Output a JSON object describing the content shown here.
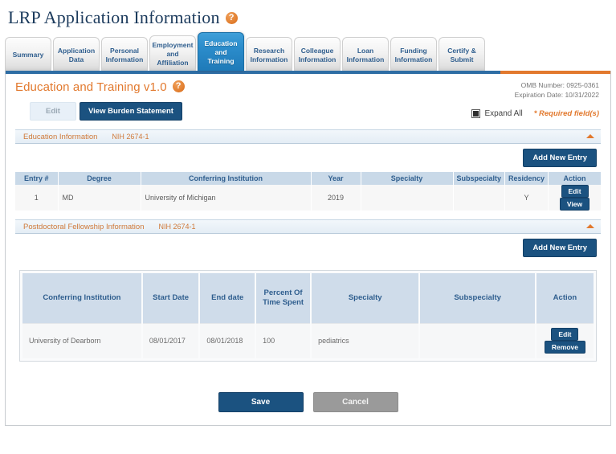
{
  "header": {
    "title": "LRP Application Information",
    "help_icon": "help-question-icon",
    "help_glyph": "?"
  },
  "tabs": [
    {
      "label": "Summary",
      "active": false
    },
    {
      "label": "Application Data",
      "active": false
    },
    {
      "label": "Personal Information",
      "active": false
    },
    {
      "label": "Employment and Affiliation",
      "active": false
    },
    {
      "label": "Education and Training",
      "active": true
    },
    {
      "label": "Research Information",
      "active": false
    },
    {
      "label": "Colleague Information",
      "active": false
    },
    {
      "label": "Loan Information",
      "active": false
    },
    {
      "label": "Funding Information",
      "active": false
    },
    {
      "label": "Certify & Submit",
      "active": false
    }
  ],
  "form": {
    "title": "Education and Training v1.0",
    "help_glyph": "?",
    "omb_number": "OMB Number: 0925-0361",
    "expiration_date": "Expiration Date: 10/31/2022",
    "edit_label": "Edit",
    "burden_label": "View Burden Statement",
    "expand_all_label": "Expand All",
    "required_note": "* Required field(s)"
  },
  "education_section": {
    "label": "Education Information",
    "form_number": "NIH 2674-1",
    "add_label": "Add New Entry",
    "columns": [
      "Entry #",
      "Degree",
      "Conferring Institution",
      "Year",
      "Specialty",
      "Subspecialty",
      "Residency",
      "Action"
    ],
    "rows": [
      {
        "entry": "1",
        "degree": "MD",
        "institution": "University of Michigan",
        "year": "2019",
        "specialty": "",
        "subspecialty": "",
        "residency": "Y",
        "actions": [
          "Edit",
          "View"
        ]
      }
    ]
  },
  "postdoc_section": {
    "label": "Postdoctoral Fellowship Information",
    "form_number": "NIH 2674-1",
    "add_label": "Add New Entry",
    "columns": [
      "Conferring Institution",
      "Start Date",
      "End date",
      "Percent Of Time Spent",
      "Specialty",
      "Subspecialty",
      "Action"
    ],
    "rows": [
      {
        "institution": "University of Dearborn",
        "start_date": "08/01/2017",
        "end_date": "08/01/2018",
        "percent": "100",
        "specialty": "pediatrics",
        "subspecialty": "",
        "actions": [
          "Edit",
          "Remove"
        ]
      }
    ]
  },
  "footer": {
    "save_label": "Save",
    "cancel_label": "Cancel"
  },
  "colors": {
    "brand_blue": "#2e6da4",
    "brand_orange": "#e2792e",
    "active_tab": "#1f7ab8",
    "button_navy": "#1b5280",
    "table_header": "#c9d9e8"
  }
}
